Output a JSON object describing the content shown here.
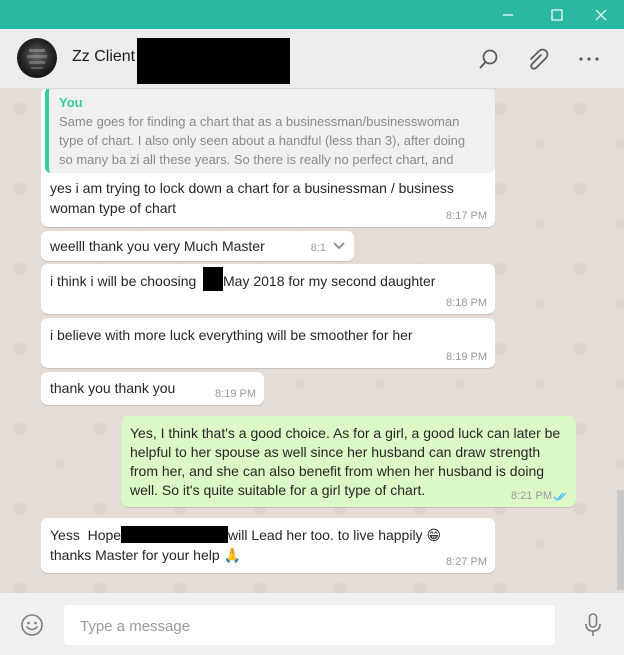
{
  "window": {
    "controls": [
      "minimize",
      "maximize",
      "close"
    ]
  },
  "header": {
    "contact_name": "Zz Client",
    "icons": [
      "search-icon",
      "attach-icon",
      "more-options-icon"
    ]
  },
  "colors": {
    "titlebar": "#2ab9a0",
    "outgoing_bubble": "#dcf8c6",
    "incoming_bubble": "#ffffff",
    "quote_accent": "#35cd96",
    "read_ticks": "#4fc3f7"
  },
  "messages": [
    {
      "direction": "incoming",
      "quote": {
        "author": "You",
        "lines": [
          "Same goes for finding a chart that as a businessman/businesswoman",
          "type of chart. I also only seen about a handful (less than 3), after doing",
          "so many ba zi all these years. So there is really no perfect chart, and"
        ]
      },
      "lines": [
        "yes i am trying to lock down a chart for a businessman / business",
        "woman type of chart"
      ],
      "time": "8:17 PM"
    },
    {
      "direction": "incoming",
      "lines": [
        "weelll thank you very Much Master"
      ],
      "time": "8:1"
    },
    {
      "direction": "incoming",
      "lines": [
        "i think i will be choosing",
        "May 2018 for my second daughter"
      ],
      "time": "8:18 PM"
    },
    {
      "direction": "incoming",
      "lines": [
        "i believe with more luck everything will be smoother for her"
      ],
      "time": "8:19 PM"
    },
    {
      "direction": "incoming",
      "lines": [
        "thank you thank you"
      ],
      "time": "8:19 PM"
    },
    {
      "direction": "outgoing",
      "lines": [
        "Yes, I think that's a good choice. As for a girl, a good luck can later be",
        "helpful to her spouse as well since her husband can draw strength",
        "from her, and she can also benefit from when her husband is doing",
        "well. So it's quite suitable for a girl type of chart."
      ],
      "time": "8:21 PM",
      "status_icon": "double-check-icon"
    },
    {
      "direction": "incoming",
      "lines": [
        "Yess  Hope",
        "will Lead her too. to live happily 😁",
        "thanks Master for your help 🙏"
      ],
      "time": "8:27 PM"
    }
  ],
  "footer": {
    "placeholder": "Type a message",
    "value": "",
    "icons": [
      "emoji-icon",
      "microphone-icon"
    ]
  }
}
